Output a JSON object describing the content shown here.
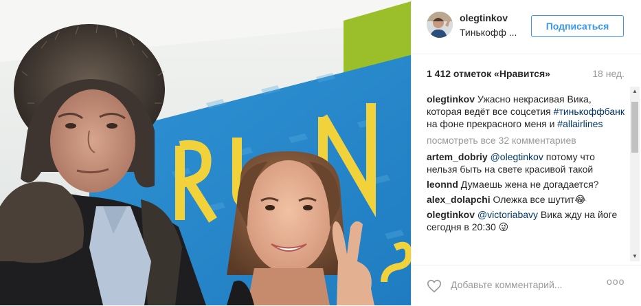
{
  "post": {
    "username": "olegtinkov",
    "location": "Тинькофф ...",
    "follow_label": "Подписаться",
    "likes": "1 412 отметок «Нравится»",
    "age": "18 нед.",
    "caption": {
      "user": "olegtinkov",
      "text_before": "Ужасно некрасивая Вика, которая ведёт все соцсетия ",
      "tag1": "#тинькоффбанк",
      "text_middle": " на фоне прекрасного меня и ",
      "tag2": "#allairlines"
    },
    "view_all": "посмотреть все 32 комментариев",
    "comments": [
      {
        "user": "artem_dobriy",
        "mention": "@olegtinkov",
        "text": " потому что нельзя быть на свете красивой такой"
      },
      {
        "user": "leonnd",
        "mention": "",
        "text": "Думаешь жена не догадается?"
      },
      {
        "user": "alex_dolapchi",
        "mention": "",
        "text": "Олежка все шутит😂"
      },
      {
        "user": "olegtinkov",
        "mention": "@victoriabavy",
        "text": " Вика жду на йоге сегодня в 20:30 😜"
      }
    ],
    "add_comment_placeholder": "Добавьте комментарий...",
    "more_label": "ooo"
  },
  "colors": {
    "accent": "#3897f0",
    "hashtag": "#003569",
    "muted": "#999999",
    "wall_blue": "#2c8fd0",
    "wall_green": "#9bbf2a",
    "letter_yellow": "#f2d23a"
  },
  "icons": [
    "heart-icon",
    "more-options-icon",
    "avatar"
  ]
}
